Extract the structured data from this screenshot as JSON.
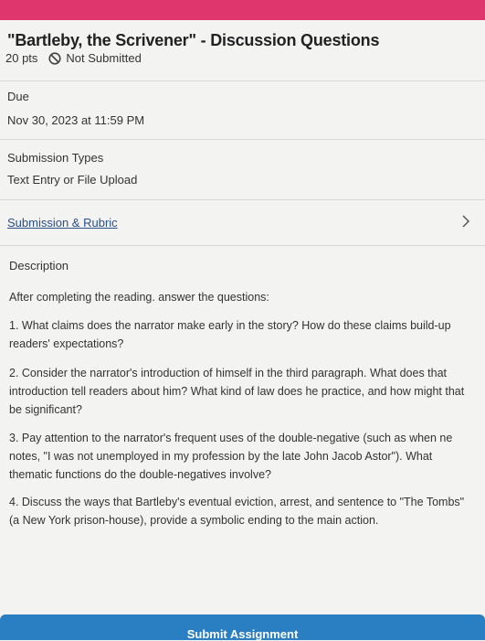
{
  "assignment": {
    "title": "\"Bartleby, the Scrivener\" - Discussion Questions",
    "points": "20 pts",
    "status": "Not Submitted"
  },
  "due": {
    "label": "Due",
    "value": "Nov 30, 2023 at 11:59 PM"
  },
  "submission_types": {
    "label": "Submission Types",
    "value": "Text Entry or File Upload"
  },
  "rubric_link": "Submission & Rubric",
  "description": {
    "heading": "Description",
    "intro": "After completing the reading. answer the questions:",
    "questions": [
      "1. What claims does the narrator make early in the story? How do these claims build-up readers' expectations?",
      "2. Consider the narrator's introduction of himself in the third paragraph. What does that introduction tell readers about him? What kind of law does he practice, and how might that be significant?",
      "3. Pay attention to the narrator's frequent uses of the double-negative (such as when ne notes, \"I was not unemployed in my profession by the late John Jacob Astor\"). What thematic functions do the double-negatives involve?",
      "4. Discuss the ways that Bartleby's eventual eviction, arrest, and sentence to \"The Tombs\" (a New York prison-house), provide a symbolic ending to the main action."
    ]
  },
  "submit_button": "Submit Assignment",
  "colors": {
    "top_bar": "#e0366e",
    "submit_bar": "#2a7ec2",
    "link": "#2b4f8a"
  },
  "icons": {
    "status": "not-submitted-icon",
    "chevron": "chevron-right-icon"
  }
}
